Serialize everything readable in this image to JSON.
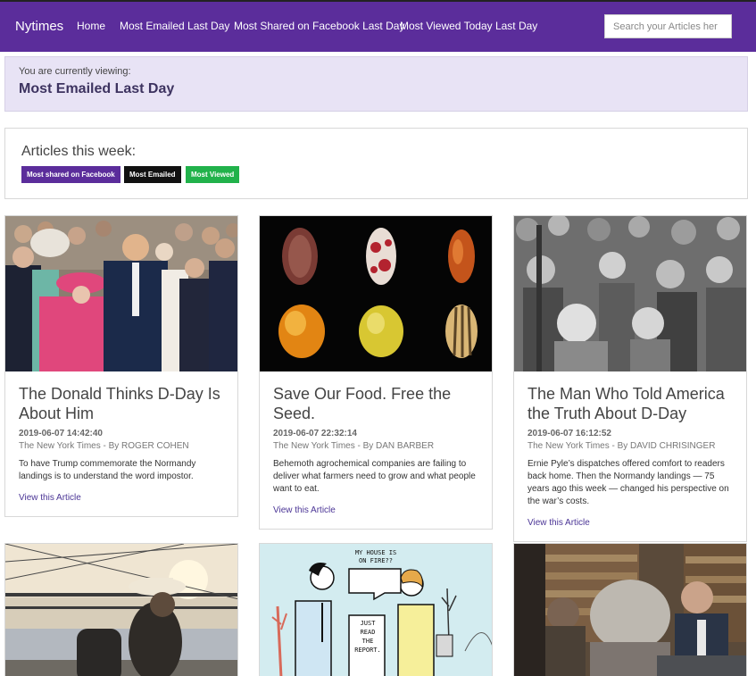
{
  "navbar": {
    "brand": "Nytimes",
    "links": [
      "Home",
      "Most Emailed Last Day",
      "Most Shared on Facebook Last Day",
      "Most Viewed Today Last Day"
    ],
    "search_placeholder": "Search your Articles her"
  },
  "viewing": {
    "label": "You are currently viewing:",
    "title": "Most Emailed Last Day"
  },
  "week": {
    "title": "Articles this week:",
    "tags": [
      {
        "label": "Most shared on Facebook",
        "color": "#5b2d9b"
      },
      {
        "label": "Most Emailed",
        "color": "#111111"
      },
      {
        "label": "Most Viewed",
        "color": "#21b24b"
      }
    ]
  },
  "articles": [
    {
      "title": "The Donald Thinks D-Day Is About Him",
      "date": "2019-06-07 14:42:40",
      "byline": "The New York Times - By ROGER COHEN",
      "abstract": "To have Trump commemorate the Normandy landings is to understand the word impostor.",
      "link": "View this Article",
      "image": "photo-dday-leaders"
    },
    {
      "title": "Save Our Food. Free the Seed.",
      "date": "2019-06-07 22:32:14",
      "byline": "The New York Times - By DAN BARBER",
      "abstract": "Behemoth agrochemical companies are failing to deliver what farmers need to grow and what people want to eat.",
      "link": "View this Article",
      "image": "photo-seeds"
    },
    {
      "title": "The Man Who Told America the Truth About D-Day",
      "date": "2019-06-07 16:12:52",
      "byline": "The New York Times - By DAVID CHRISINGER",
      "abstract": "Ernie Pyle’s dispatches offered comfort to readers back home. Then the Normandy landings — 75 years ago this week — changed his perspective on the war’s costs.",
      "link": "View this Article",
      "image": "photo-wartime-crowd"
    },
    {
      "image": "photo-border-fence"
    },
    {
      "image": "illustration-climate-report"
    },
    {
      "image": "photo-meeting-library"
    }
  ],
  "illustration": {
    "bubble_top": "MY HOUSE IS ON FIRE??",
    "bubble_bottom": "JUST READ THE REPORT."
  },
  "colors": {
    "brand": "#5b2d9b",
    "viewing_bg": "#e8e3f5",
    "link": "#4b3596"
  }
}
